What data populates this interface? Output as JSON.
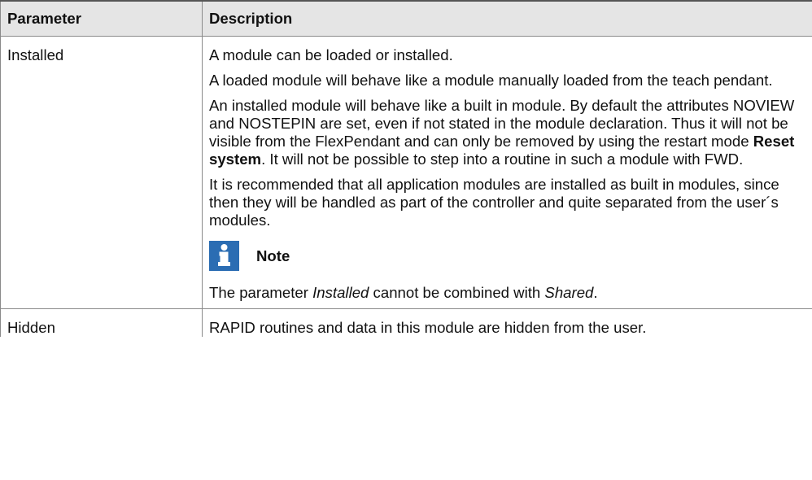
{
  "table": {
    "headers": [
      "Parameter",
      "Description"
    ],
    "rows": [
      {
        "parameter": "Installed",
        "paragraphs": [
          "A module can be loaded or installed.",
          "A loaded module will behave like a module manually loaded from the teach pendant."
        ],
        "installed_para": {
          "pre": "An installed module will behave like a built in module. By default the attributes NOVIEW and NOSTEPIN are set, even if not stated in the module declaration. Thus it will not be visible from the FlexPendant and can only be removed by using the restart mode ",
          "bold": "Reset system",
          "post": ". It will not be possible to step into a routine in such a module with FWD."
        },
        "recommend": "It is recommended that all application modules are installed as built in modules, since then they will be handled as part of the controller and quite separated from the user´s modules.",
        "note": {
          "icon": "info-icon",
          "label": "Note",
          "text_pre": "The parameter ",
          "text_em1": "Installed",
          "text_mid": " cannot be combined with ",
          "text_em2": "Shared",
          "text_post": "."
        }
      },
      {
        "parameter": "Hidden",
        "description": "RAPID routines and data in this module are hidden from the user."
      }
    ]
  },
  "colors": {
    "header_bg": "#e5e5e5",
    "border": "#8a8a8a",
    "note_icon_bg": "#2b6db3"
  }
}
